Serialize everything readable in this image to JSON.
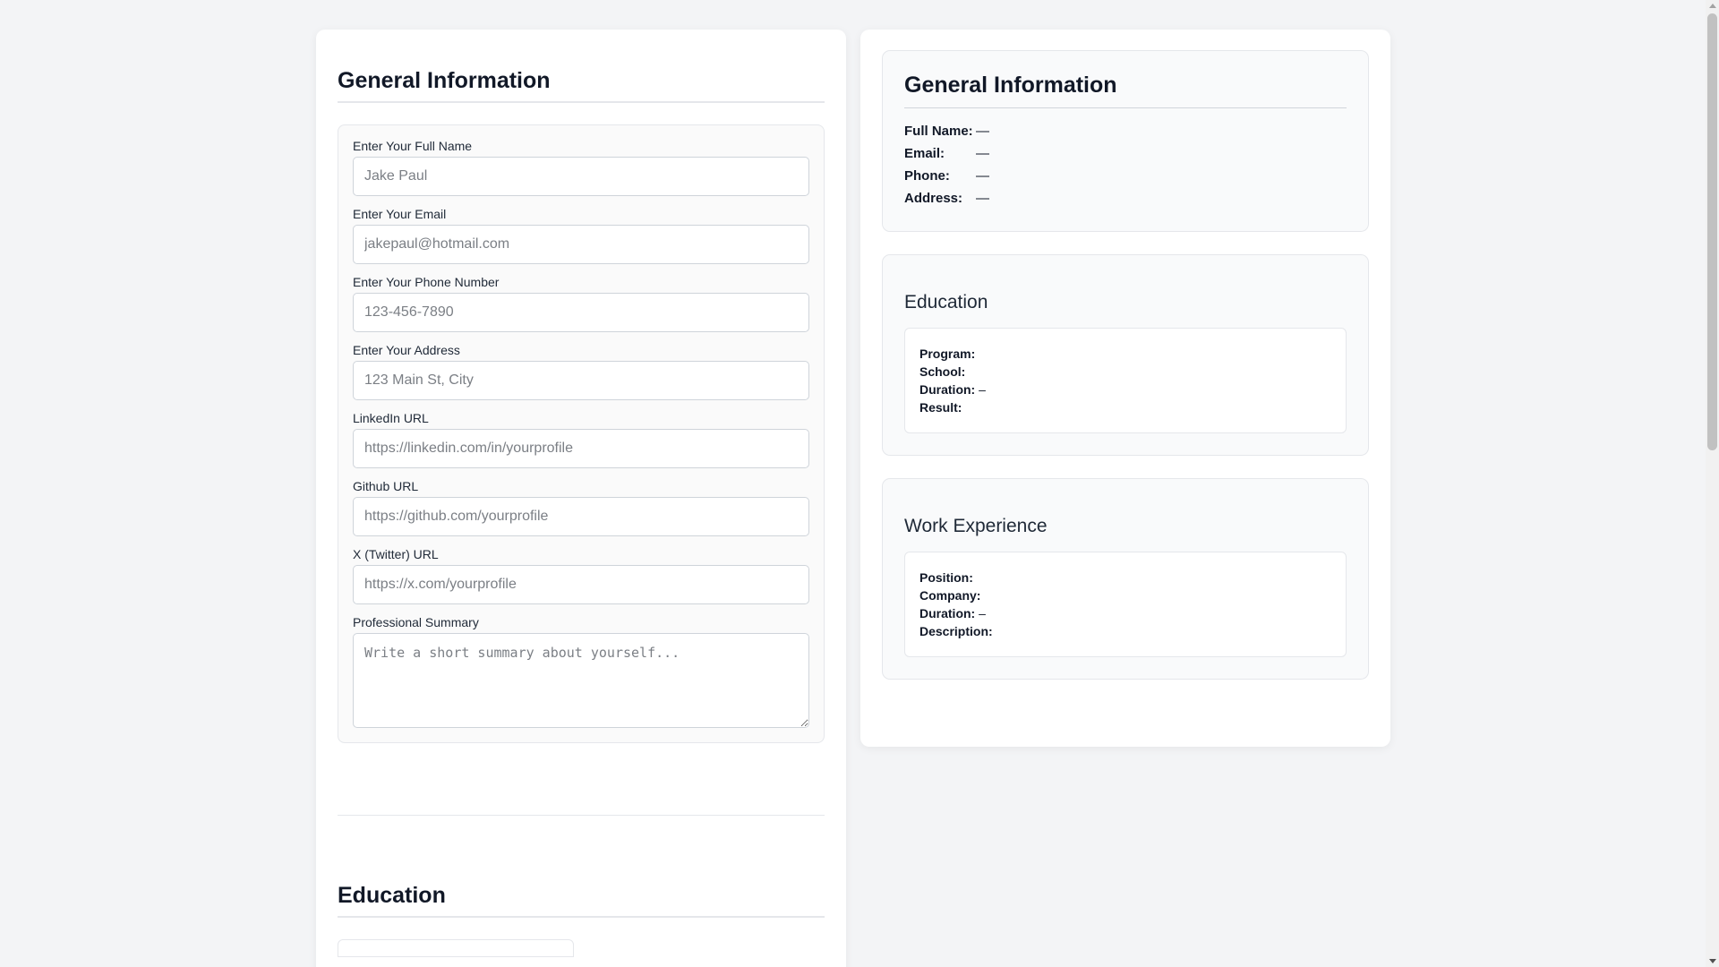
{
  "form": {
    "general_title": "General Information",
    "fields": [
      {
        "label": "Enter Your Full Name",
        "placeholder": "Jake Paul"
      },
      {
        "label": "Enter Your Email",
        "placeholder": "jakepaul@hotmail.com"
      },
      {
        "label": "Enter Your Phone Number",
        "placeholder": "123-456-7890"
      },
      {
        "label": "Enter Your Address",
        "placeholder": "123 Main St, City"
      },
      {
        "label": "LinkedIn URL",
        "placeholder": "https://linkedin.com/in/yourprofile"
      },
      {
        "label": "Github URL",
        "placeholder": "https://github.com/yourprofile"
      },
      {
        "label": "X (Twitter) URL",
        "placeholder": "https://x.com/yourprofile"
      }
    ],
    "summary": {
      "label": "Professional Summary",
      "placeholder": "Write a short summary about yourself..."
    },
    "education_title": "Education"
  },
  "preview": {
    "general": {
      "title": "General Information",
      "rows": [
        {
          "key": "Full Name:",
          "value": "—"
        },
        {
          "key": "Email:",
          "value": "—"
        },
        {
          "key": "Phone:",
          "value": "—"
        },
        {
          "key": "Address:",
          "value": "—"
        }
      ]
    },
    "education": {
      "title": "Education",
      "program_label": "Program:",
      "school_label": "School:",
      "duration_label": "Duration:",
      "duration_value": " –",
      "result_label": "Result:"
    },
    "work": {
      "title": "Work Experience",
      "position_label": "Position:",
      "company_label": "Company:",
      "duration_label": "Duration:",
      "duration_value": " –",
      "description_label": "Description:"
    }
  }
}
